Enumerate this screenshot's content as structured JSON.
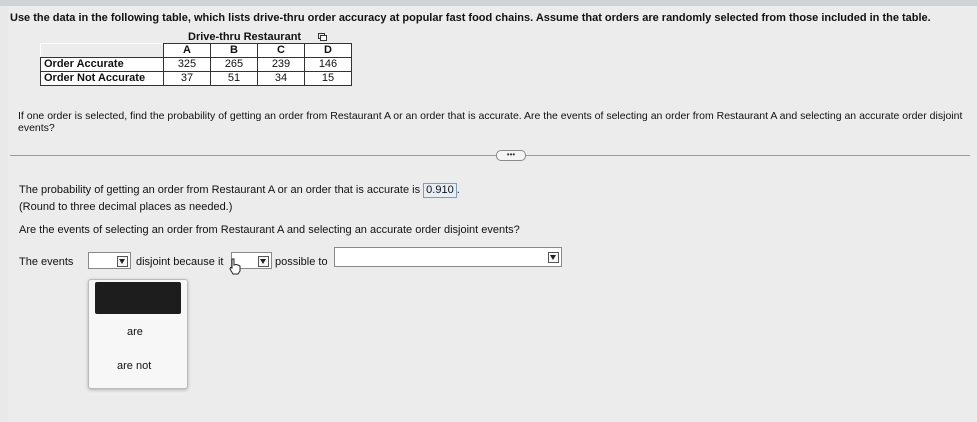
{
  "instruction": "Use the data in the following table, which lists drive-thru order accuracy at popular fast food chains. Assume that orders are randomly selected from those included in the table.",
  "table": {
    "title": "Drive-thru Restaurant",
    "columns": [
      "A",
      "B",
      "C",
      "D"
    ],
    "rows": [
      {
        "label": "Order Accurate",
        "values": [
          "325",
          "265",
          "239",
          "146"
        ]
      },
      {
        "label": "Order Not Accurate",
        "values": [
          "37",
          "51",
          "34",
          "15"
        ]
      }
    ]
  },
  "question": "If one order is selected, find the probability of getting an order from Restaurant A or an order that is accurate. Are the events of selecting an order from Restaurant A and selecting an accurate order disjoint events?",
  "more_button": "•••",
  "answer": {
    "prob_prefix": "The probability of getting an order from Restaurant A or an order that is accurate is",
    "prob_value": "0.910",
    "prob_suffix": ".",
    "round_note": "(Round to three decimal places as needed.)",
    "disjoint_question": "Are the events of selecting an order from Restaurant A and selecting an accurate order disjoint events?",
    "sentence_prefix": "The events",
    "sentence_mid1": "disjoint because it",
    "sentence_mid2": "possible to"
  },
  "popup_options": [
    "are",
    "are not"
  ],
  "icons": {
    "copy": "copy-icon",
    "dropdown": "chevron-down-icon",
    "cursor": "hand-cursor-icon"
  }
}
